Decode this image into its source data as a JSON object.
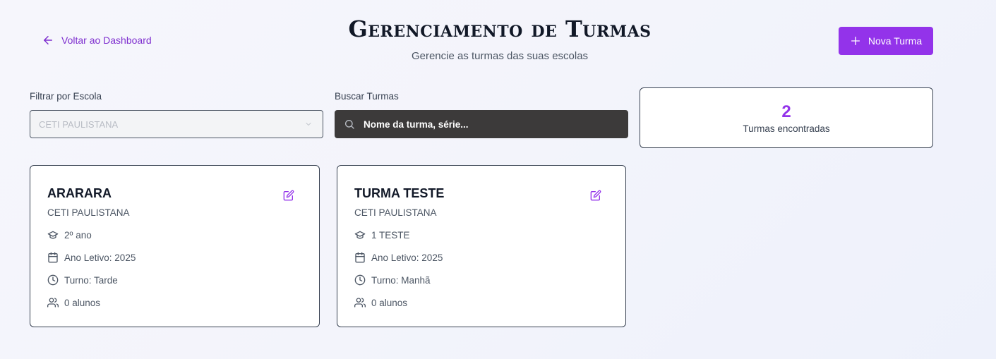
{
  "header": {
    "back_label": "Voltar ao Dashboard",
    "title": "Gerenciamento de Turmas",
    "subtitle": "Gerencie as turmas das suas escolas",
    "new_button_label": "Nova Turma"
  },
  "filters": {
    "school_label": "Filtrar por Escola",
    "school_value": "CETI PAULISTANA",
    "search_label": "Buscar Turmas",
    "search_placeholder": "Nome da turma, série..."
  },
  "summary": {
    "count": "2",
    "count_label": "Turmas encontradas"
  },
  "colors": {
    "accent": "#9333ea",
    "search_bg": "#3c3a3a"
  },
  "classes": [
    {
      "name": "ARARARA",
      "school": "CETI PAULISTANA",
      "grade": "2º ano",
      "year": "Ano Letivo: 2025",
      "shift": "Turno: Tarde",
      "students": "0 alunos"
    },
    {
      "name": "TURMA TESTE",
      "school": "CETI PAULISTANA",
      "grade": "1 TESTE",
      "year": "Ano Letivo: 2025",
      "shift": "Turno: Manhã",
      "students": "0 alunos"
    }
  ]
}
